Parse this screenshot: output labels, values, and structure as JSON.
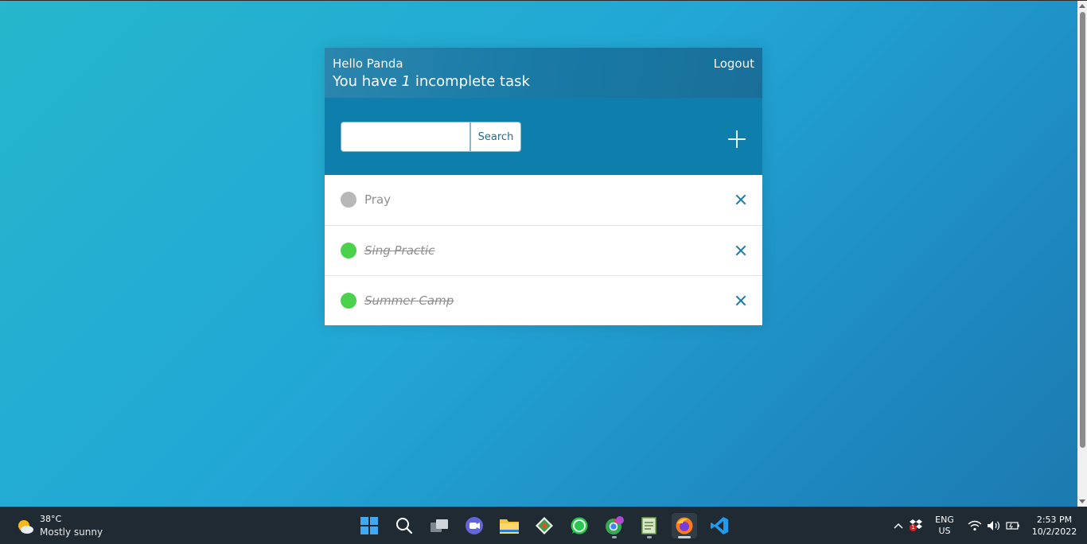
{
  "app": {
    "greeting": "Hello Panda",
    "summary_prefix": "You have ",
    "incomplete_count": "1",
    "summary_suffix": " incomplete task",
    "logout_label": "Logout",
    "search": {
      "placeholder": "",
      "value": "",
      "button_label": "Search"
    },
    "add_icon": "plus-icon",
    "tasks": [
      {
        "label": "Pray",
        "completed": false,
        "status_color": "#b8b8b8"
      },
      {
        "label": "Sing Practic",
        "completed": true,
        "status_color": "#4cd14c"
      },
      {
        "label": "Summer Camp",
        "completed": true,
        "status_color": "#4cd14c"
      }
    ],
    "colors": {
      "header": "#1a7ba6",
      "toolbar": "#0e7fad",
      "accent": "#1a7ba6"
    }
  },
  "taskbar": {
    "weather": {
      "temp": "38°C",
      "description": "Mostly sunny",
      "icon": "partly-sunny-icon"
    },
    "apps": [
      {
        "name": "start-icon"
      },
      {
        "name": "search-icon"
      },
      {
        "name": "task-view-icon"
      },
      {
        "name": "chat-icon"
      },
      {
        "name": "file-explorer-icon"
      },
      {
        "name": "git-app-icon"
      },
      {
        "name": "whatsapp-icon"
      },
      {
        "name": "chrome-icon"
      },
      {
        "name": "notepad-icon"
      },
      {
        "name": "firefox-icon",
        "active": true
      },
      {
        "name": "vscode-icon"
      }
    ],
    "tray": {
      "language": "ENG",
      "region": "US",
      "time": "2:53 PM",
      "date": "10/2/2022",
      "dropbox_badge": "1"
    }
  }
}
